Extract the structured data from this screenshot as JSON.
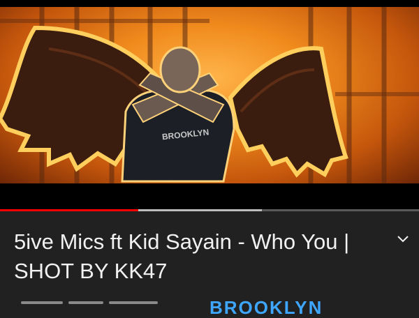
{
  "video": {
    "title": "5ive Mics ft Kid Sayain - Who You | SHOT BY KK47",
    "progress_played": 0.33,
    "progress_buffered": 0.625,
    "progress_color": "#ff0000",
    "shirt_text": "BROOKLYN"
  },
  "details": {
    "expand_icon": "chevron-down-icon",
    "channel_peek": "BROOKLYN"
  }
}
